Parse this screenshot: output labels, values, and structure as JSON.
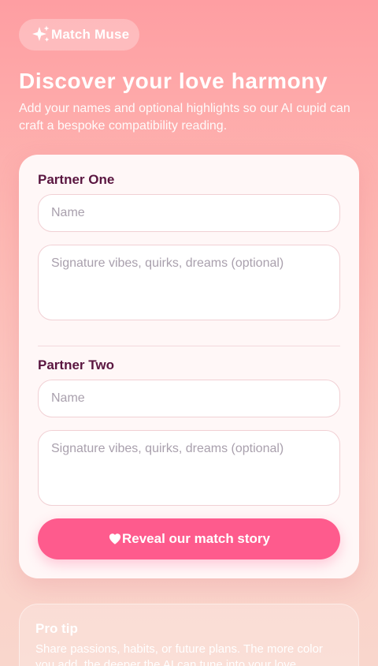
{
  "app": {
    "brand_name": "Match Muse",
    "brand_icon": "sparkles-icon"
  },
  "hero": {
    "title": "Discover your love harmony",
    "subtitle": "Add your names and optional highlights so our AI cupid can craft a bespoke compatibility reading."
  },
  "form": {
    "partner_one": {
      "label": "Partner One",
      "name_placeholder": "Name",
      "name_value": "",
      "notes_placeholder": "Signature vibes, quirks, dreams (optional)",
      "notes_value": ""
    },
    "partner_two": {
      "label": "Partner Two",
      "name_placeholder": "Name",
      "name_value": "",
      "notes_placeholder": "Signature vibes, quirks, dreams (optional)",
      "notes_value": ""
    },
    "submit_label": "Reveal our match story",
    "submit_icon": "heart-icon"
  },
  "tip": {
    "title": "Pro tip",
    "body": "Share passions, habits, or future plans. The more color you add, the deeper the AI can tune into your love"
  },
  "colors": {
    "accent": "#fe5b8d",
    "heading_text": "#5a1640",
    "card_background": "#fff7f7"
  }
}
